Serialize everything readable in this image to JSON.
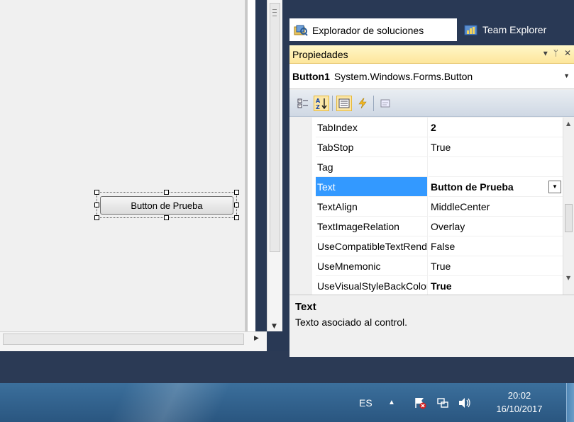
{
  "designer": {
    "button_text": "Button de Prueba"
  },
  "tabs": [
    {
      "label": "Explorador de soluciones",
      "icon": "solution-explorer-icon"
    },
    {
      "label": "Team Explorer",
      "icon": "team-explorer-icon"
    }
  ],
  "properties_window": {
    "title": "Propiedades",
    "title_controls": [
      "▾",
      "ᛘ",
      "✕"
    ],
    "object_name": "Button1",
    "object_type": "System.Windows.Forms.Button",
    "toolbar": [
      "categorized-icon",
      "alphabetical-icon",
      "properties-icon",
      "events-icon",
      "property-pages-icon"
    ],
    "rows": [
      {
        "name": "TabIndex",
        "value": "2",
        "bold": true
      },
      {
        "name": "TabStop",
        "value": "True",
        "bold": false
      },
      {
        "name": "Tag",
        "value": "",
        "bold": false
      },
      {
        "name": "Text",
        "value": "Button de Prueba",
        "bold": true,
        "selected": true
      },
      {
        "name": "TextAlign",
        "value": "MiddleCenter",
        "bold": false
      },
      {
        "name": "TextImageRelation",
        "value": "Overlay",
        "bold": false
      },
      {
        "name": "UseCompatibleTextRendering",
        "value": "False",
        "bold": false
      },
      {
        "name": "UseMnemonic",
        "value": "True",
        "bold": false
      },
      {
        "name": "UseVisualStyleBackColor",
        "value": "True",
        "bold": true
      }
    ],
    "description_title": "Text",
    "description_text": "Texto asociado al control."
  },
  "taskbar": {
    "language": "ES",
    "time": "20:02",
    "date": "16/10/2017"
  },
  "colors": {
    "selection": "#3399ff",
    "title_bar": "#fde69c",
    "vs_frame": "#293955"
  }
}
